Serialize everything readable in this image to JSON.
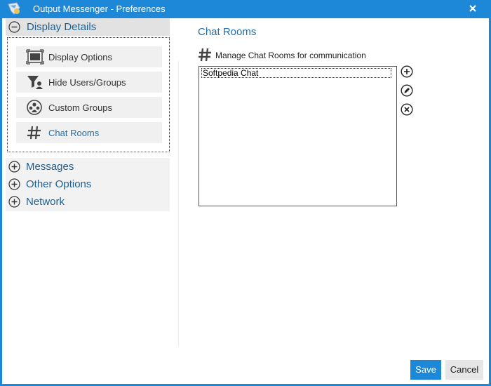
{
  "window": {
    "title": "Output Messenger - Preferences",
    "close_glyph": "✕"
  },
  "sidebar": {
    "display_details": {
      "label": "Display Details",
      "state": "expanded",
      "items": [
        {
          "label": "Display Options",
          "icon": "display-icon"
        },
        {
          "label": "Hide Users/Groups",
          "icon": "filter-users-icon"
        },
        {
          "label": "Custom Groups",
          "icon": "group-icon"
        },
        {
          "label": "Chat Rooms",
          "icon": "hash-icon",
          "active": true
        }
      ]
    },
    "collapsed_sections": [
      {
        "label": "Messages",
        "state": "collapsed"
      },
      {
        "label": "Other Options",
        "state": "collapsed"
      },
      {
        "label": "Network",
        "state": "collapsed"
      }
    ]
  },
  "main": {
    "title": "Chat Rooms",
    "subtitle": "Manage Chat Rooms for communication",
    "rooms": [
      "Softpedia Chat"
    ],
    "actions": [
      {
        "name": "add-room",
        "icon": "plus-icon"
      },
      {
        "name": "edit-room",
        "icon": "pencil-icon"
      },
      {
        "name": "delete-room",
        "icon": "x-icon"
      }
    ]
  },
  "footer": {
    "save_label": "Save",
    "cancel_label": "Cancel"
  },
  "colors": {
    "accent": "#1e88d8",
    "link": "#1f6fae"
  }
}
